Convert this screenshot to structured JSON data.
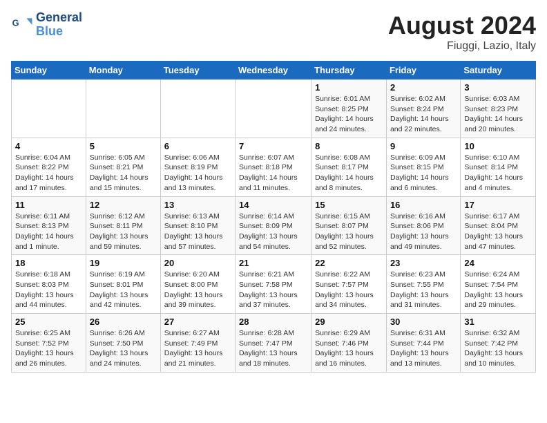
{
  "logo": {
    "name": "General",
    "name2": "Blue"
  },
  "title": "August 2024",
  "subtitle": "Fiuggi, Lazio, Italy",
  "days_of_week": [
    "Sunday",
    "Monday",
    "Tuesday",
    "Wednesday",
    "Thursday",
    "Friday",
    "Saturday"
  ],
  "weeks": [
    [
      {
        "num": "",
        "info": ""
      },
      {
        "num": "",
        "info": ""
      },
      {
        "num": "",
        "info": ""
      },
      {
        "num": "",
        "info": ""
      },
      {
        "num": "1",
        "info": "Sunrise: 6:01 AM\nSunset: 8:25 PM\nDaylight: 14 hours and 24 minutes."
      },
      {
        "num": "2",
        "info": "Sunrise: 6:02 AM\nSunset: 8:24 PM\nDaylight: 14 hours and 22 minutes."
      },
      {
        "num": "3",
        "info": "Sunrise: 6:03 AM\nSunset: 8:23 PM\nDaylight: 14 hours and 20 minutes."
      }
    ],
    [
      {
        "num": "4",
        "info": "Sunrise: 6:04 AM\nSunset: 8:22 PM\nDaylight: 14 hours and 17 minutes."
      },
      {
        "num": "5",
        "info": "Sunrise: 6:05 AM\nSunset: 8:21 PM\nDaylight: 14 hours and 15 minutes."
      },
      {
        "num": "6",
        "info": "Sunrise: 6:06 AM\nSunset: 8:19 PM\nDaylight: 14 hours and 13 minutes."
      },
      {
        "num": "7",
        "info": "Sunrise: 6:07 AM\nSunset: 8:18 PM\nDaylight: 14 hours and 11 minutes."
      },
      {
        "num": "8",
        "info": "Sunrise: 6:08 AM\nSunset: 8:17 PM\nDaylight: 14 hours and 8 minutes."
      },
      {
        "num": "9",
        "info": "Sunrise: 6:09 AM\nSunset: 8:15 PM\nDaylight: 14 hours and 6 minutes."
      },
      {
        "num": "10",
        "info": "Sunrise: 6:10 AM\nSunset: 8:14 PM\nDaylight: 14 hours and 4 minutes."
      }
    ],
    [
      {
        "num": "11",
        "info": "Sunrise: 6:11 AM\nSunset: 8:13 PM\nDaylight: 14 hours and 1 minute."
      },
      {
        "num": "12",
        "info": "Sunrise: 6:12 AM\nSunset: 8:11 PM\nDaylight: 13 hours and 59 minutes."
      },
      {
        "num": "13",
        "info": "Sunrise: 6:13 AM\nSunset: 8:10 PM\nDaylight: 13 hours and 57 minutes."
      },
      {
        "num": "14",
        "info": "Sunrise: 6:14 AM\nSunset: 8:09 PM\nDaylight: 13 hours and 54 minutes."
      },
      {
        "num": "15",
        "info": "Sunrise: 6:15 AM\nSunset: 8:07 PM\nDaylight: 13 hours and 52 minutes."
      },
      {
        "num": "16",
        "info": "Sunrise: 6:16 AM\nSunset: 8:06 PM\nDaylight: 13 hours and 49 minutes."
      },
      {
        "num": "17",
        "info": "Sunrise: 6:17 AM\nSunset: 8:04 PM\nDaylight: 13 hours and 47 minutes."
      }
    ],
    [
      {
        "num": "18",
        "info": "Sunrise: 6:18 AM\nSunset: 8:03 PM\nDaylight: 13 hours and 44 minutes."
      },
      {
        "num": "19",
        "info": "Sunrise: 6:19 AM\nSunset: 8:01 PM\nDaylight: 13 hours and 42 minutes."
      },
      {
        "num": "20",
        "info": "Sunrise: 6:20 AM\nSunset: 8:00 PM\nDaylight: 13 hours and 39 minutes."
      },
      {
        "num": "21",
        "info": "Sunrise: 6:21 AM\nSunset: 7:58 PM\nDaylight: 13 hours and 37 minutes."
      },
      {
        "num": "22",
        "info": "Sunrise: 6:22 AM\nSunset: 7:57 PM\nDaylight: 13 hours and 34 minutes."
      },
      {
        "num": "23",
        "info": "Sunrise: 6:23 AM\nSunset: 7:55 PM\nDaylight: 13 hours and 31 minutes."
      },
      {
        "num": "24",
        "info": "Sunrise: 6:24 AM\nSunset: 7:54 PM\nDaylight: 13 hours and 29 minutes."
      }
    ],
    [
      {
        "num": "25",
        "info": "Sunrise: 6:25 AM\nSunset: 7:52 PM\nDaylight: 13 hours and 26 minutes."
      },
      {
        "num": "26",
        "info": "Sunrise: 6:26 AM\nSunset: 7:50 PM\nDaylight: 13 hours and 24 minutes."
      },
      {
        "num": "27",
        "info": "Sunrise: 6:27 AM\nSunset: 7:49 PM\nDaylight: 13 hours and 21 minutes."
      },
      {
        "num": "28",
        "info": "Sunrise: 6:28 AM\nSunset: 7:47 PM\nDaylight: 13 hours and 18 minutes."
      },
      {
        "num": "29",
        "info": "Sunrise: 6:29 AM\nSunset: 7:46 PM\nDaylight: 13 hours and 16 minutes."
      },
      {
        "num": "30",
        "info": "Sunrise: 6:31 AM\nSunset: 7:44 PM\nDaylight: 13 hours and 13 minutes."
      },
      {
        "num": "31",
        "info": "Sunrise: 6:32 AM\nSunset: 7:42 PM\nDaylight: 13 hours and 10 minutes."
      }
    ]
  ]
}
